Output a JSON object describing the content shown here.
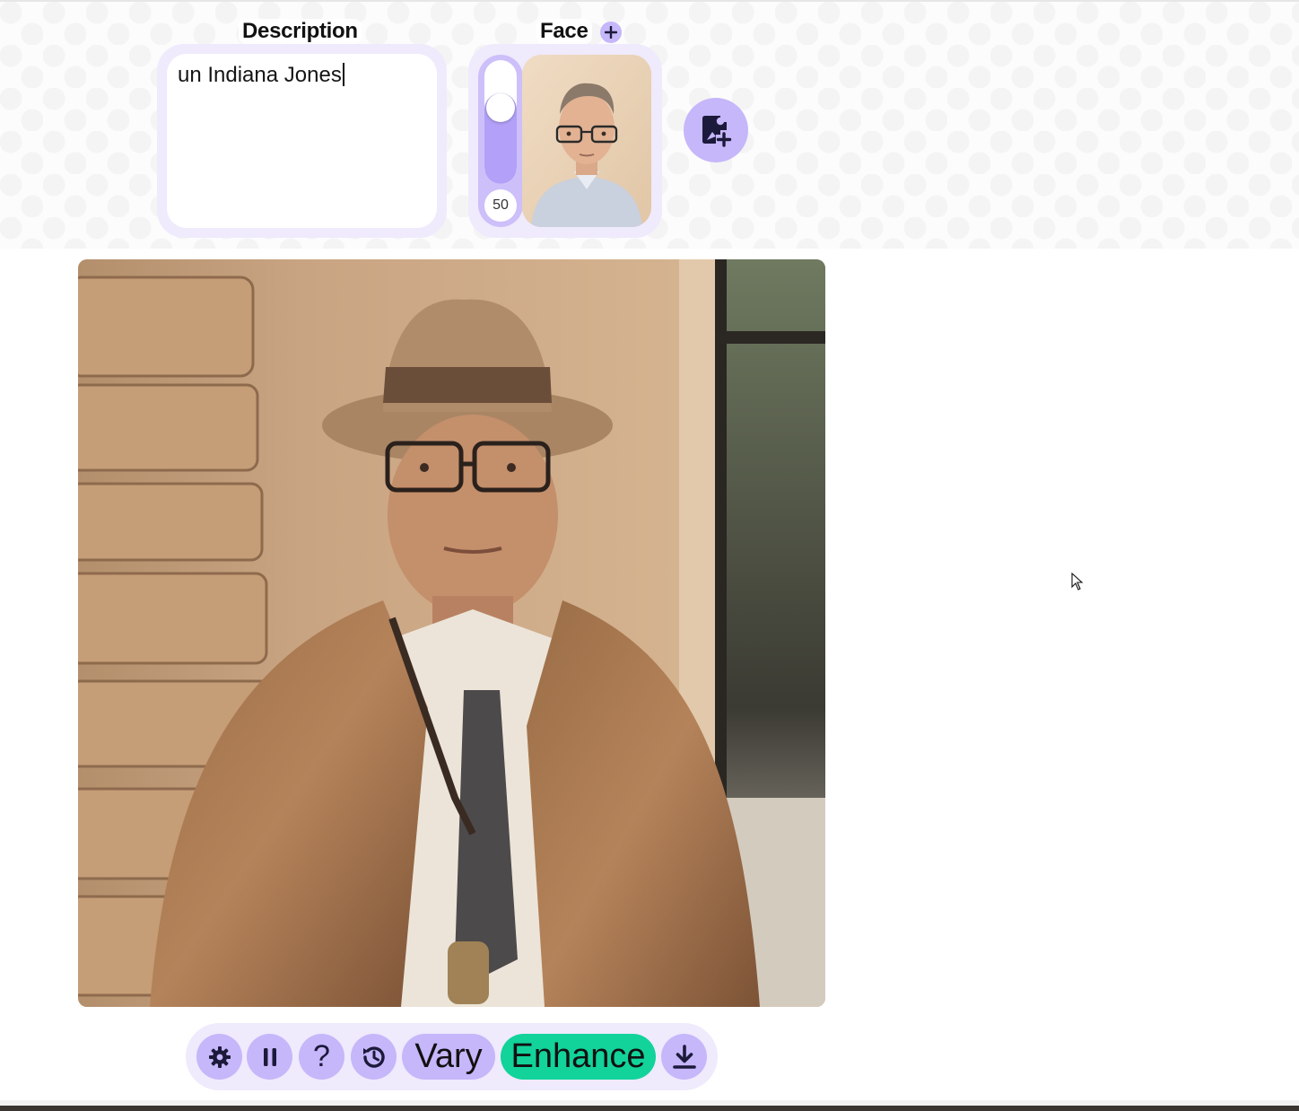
{
  "description": {
    "label": "Description",
    "value": "un Indiana Jones"
  },
  "face": {
    "label": "Face",
    "strength": 50,
    "strength_label": "50",
    "add_icon": "plus-icon"
  },
  "add_image": {
    "icon": "add-photo-icon"
  },
  "toolbar": {
    "settings_icon": "gear-icon",
    "pause_icon": "pause-icon",
    "help_label": "?",
    "history_icon": "history-icon",
    "vary_label": "Vary",
    "enhance_label": "Enhance",
    "download_icon": "download-icon"
  },
  "colors": {
    "accent": "#c6b6fa",
    "panel": "#efeafc",
    "enhance": "#12d39a"
  }
}
